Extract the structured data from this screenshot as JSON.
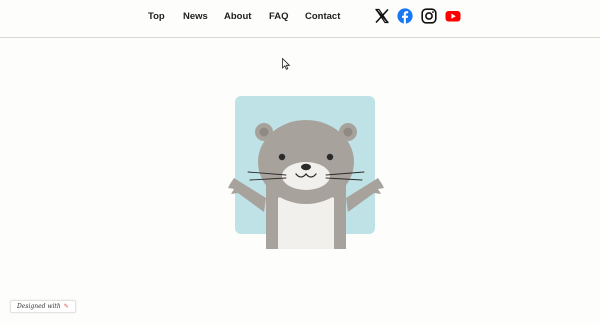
{
  "nav": {
    "items": [
      {
        "label": "Top"
      },
      {
        "label": "News"
      },
      {
        "label": "About"
      },
      {
        "label": "FAQ"
      },
      {
        "label": "Contact"
      }
    ]
  },
  "social": {
    "icons": [
      "x-icon",
      "facebook-icon",
      "instagram-icon",
      "youtube-icon"
    ]
  },
  "colors": {
    "background": "#fdfdfb",
    "illustration_bg": "#bfe2e7",
    "otter_body": "#a7a29c",
    "otter_belly": "#f2f0ec",
    "facebook": "#1877f2",
    "youtube": "#ff0000"
  },
  "badge": {
    "label": "Designed with",
    "pen": "✎"
  }
}
